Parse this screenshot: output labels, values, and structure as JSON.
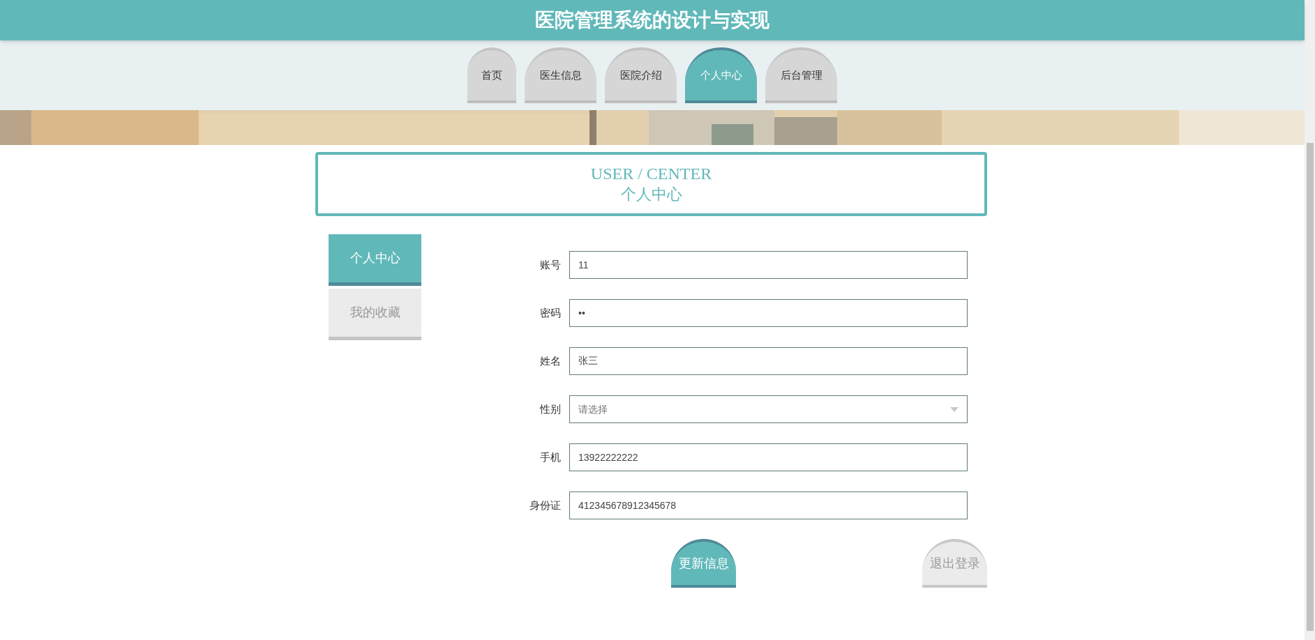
{
  "header": {
    "title": "医院管理系统的设计与实现"
  },
  "tabs": [
    {
      "label": "首页",
      "selected": false
    },
    {
      "label": "医生信息",
      "selected": false
    },
    {
      "label": "医院介绍",
      "selected": false
    },
    {
      "label": "个人中心",
      "selected": true
    },
    {
      "label": "后台管理",
      "selected": false
    }
  ],
  "title_box": {
    "english": "USER / CENTER",
    "chinese": "个人中心"
  },
  "sidebar": {
    "items": [
      {
        "label": "个人中心",
        "selected": true
      },
      {
        "label": "我的收藏",
        "selected": false
      }
    ]
  },
  "form": {
    "fields": [
      {
        "label": "账号",
        "kind": "text",
        "value": "11"
      },
      {
        "label": "密码",
        "kind": "password",
        "value": "••"
      },
      {
        "label": "姓名",
        "kind": "text",
        "value": "张三"
      },
      {
        "label": "性别",
        "kind": "select",
        "placeholder": "请选择"
      },
      {
        "label": "手机",
        "kind": "text",
        "value": "13922222222"
      },
      {
        "label": "身份证",
        "kind": "text",
        "value": "412345678912345678"
      }
    ]
  },
  "buttons": [
    {
      "label": "更新信息",
      "kind": "primary"
    },
    {
      "label": "退出登录",
      "kind": "secondary"
    }
  ]
}
